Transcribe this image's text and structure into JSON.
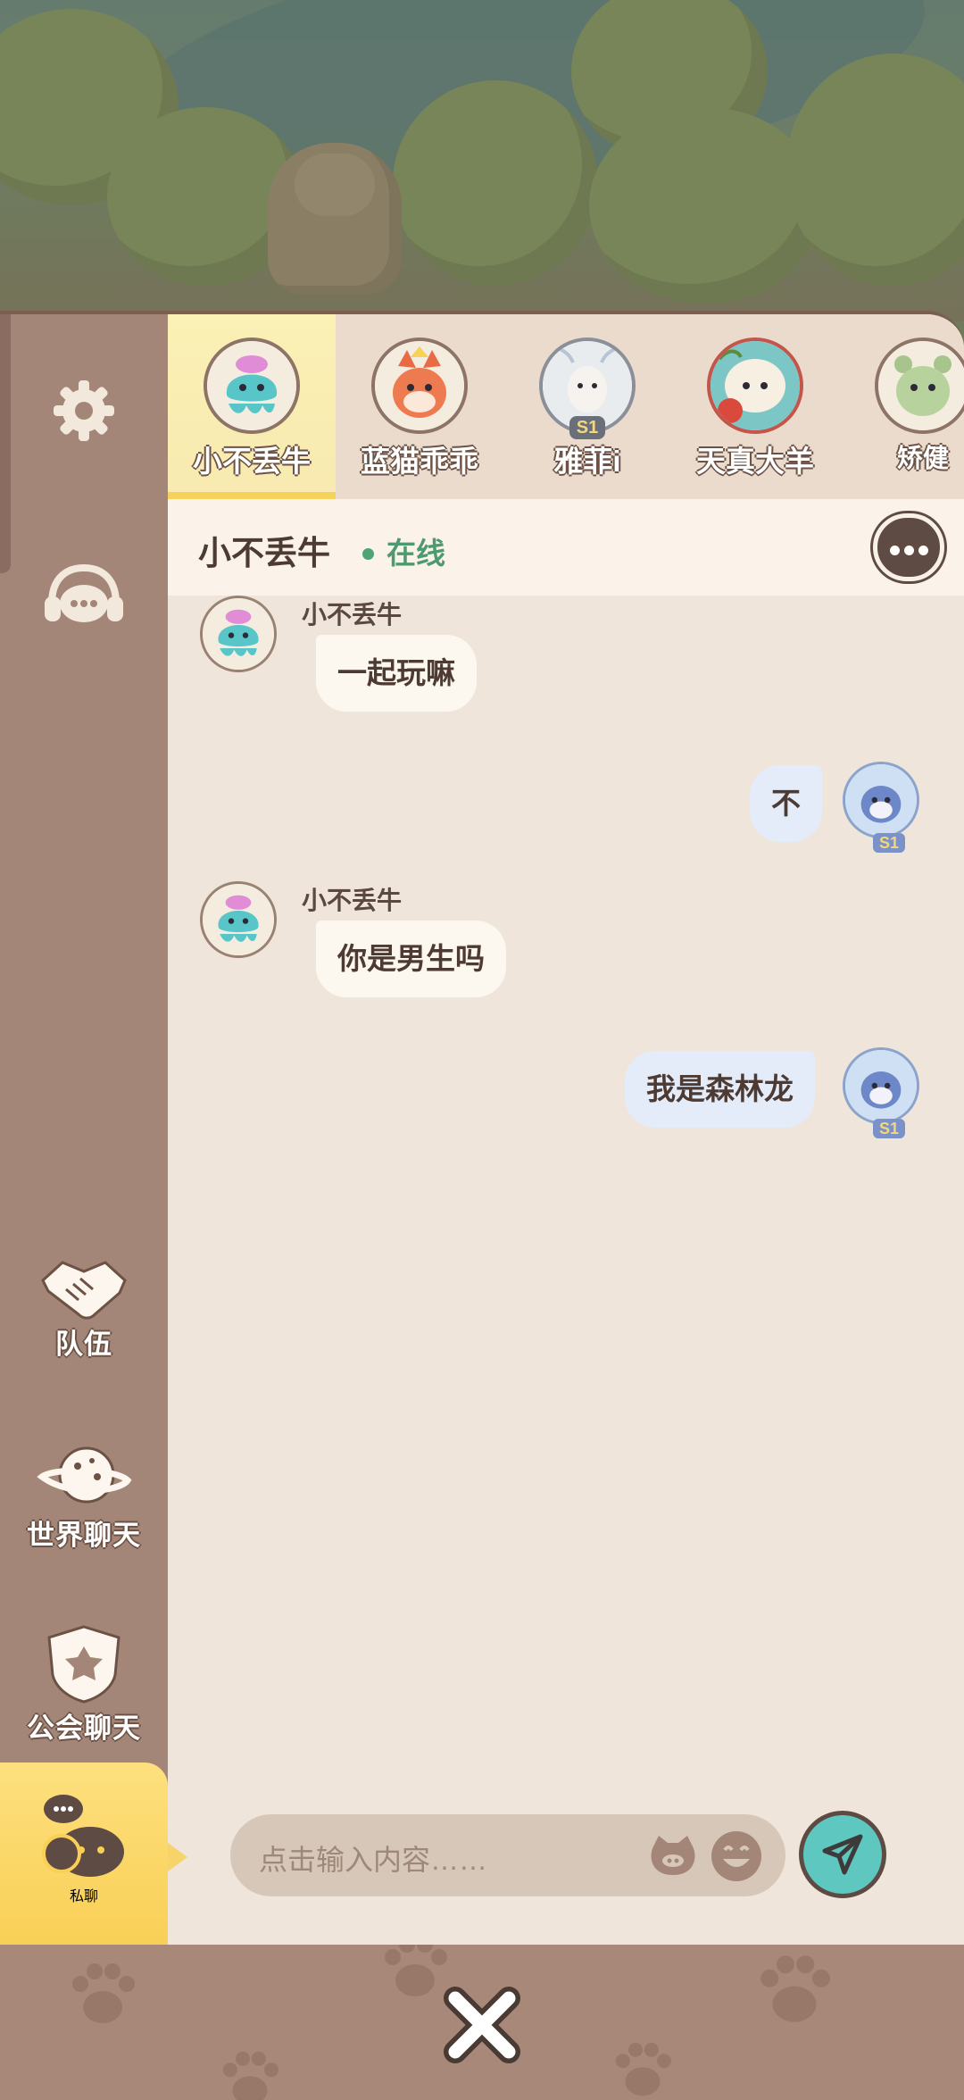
{
  "sidebar": {
    "items": [
      {
        "label": "",
        "icon": "gear-icon"
      },
      {
        "label": "",
        "icon": "headset-chat-icon"
      },
      {
        "label": "队伍",
        "icon": "handshake-icon"
      },
      {
        "label": "世界聊天",
        "icon": "planet-icon"
      },
      {
        "label": "公会聊天",
        "icon": "guild-shield-icon"
      },
      {
        "label": "私聊",
        "icon": "private-chat-icon"
      }
    ]
  },
  "contacts": [
    {
      "name": "小不丢牛",
      "avatar": "jellyfish-avatar-icon",
      "active": true
    },
    {
      "name": "蓝猫乖乖",
      "avatar": "fox-avatar-icon"
    },
    {
      "name": "雅菲i",
      "avatar": "deer-avatar-icon",
      "badge": "S1"
    },
    {
      "name": "天真大羊",
      "avatar": "sheep-avatar-icon"
    },
    {
      "name": "矫健",
      "avatar": "bear-avatar-icon"
    }
  ],
  "chat": {
    "title": "小不丢牛",
    "status": "在线",
    "status_color": "#4fa474"
  },
  "messages": [
    {
      "sender": "小不丢牛",
      "text": "一起玩嘛",
      "direction": "in"
    },
    {
      "sender": "",
      "text": "不",
      "direction": "out"
    },
    {
      "sender": "小不丢牛",
      "text": "你是男生吗",
      "direction": "in"
    },
    {
      "sender": "",
      "text": "我是森林龙",
      "direction": "out"
    }
  ],
  "self_avatar_badge": "S1",
  "input": {
    "placeholder": "点击输入内容……"
  },
  "colors": {
    "accent": "#5ec7c0",
    "active_tab": "#f9cf55",
    "sidebar": "#a38677",
    "panel": "#efe5db"
  }
}
